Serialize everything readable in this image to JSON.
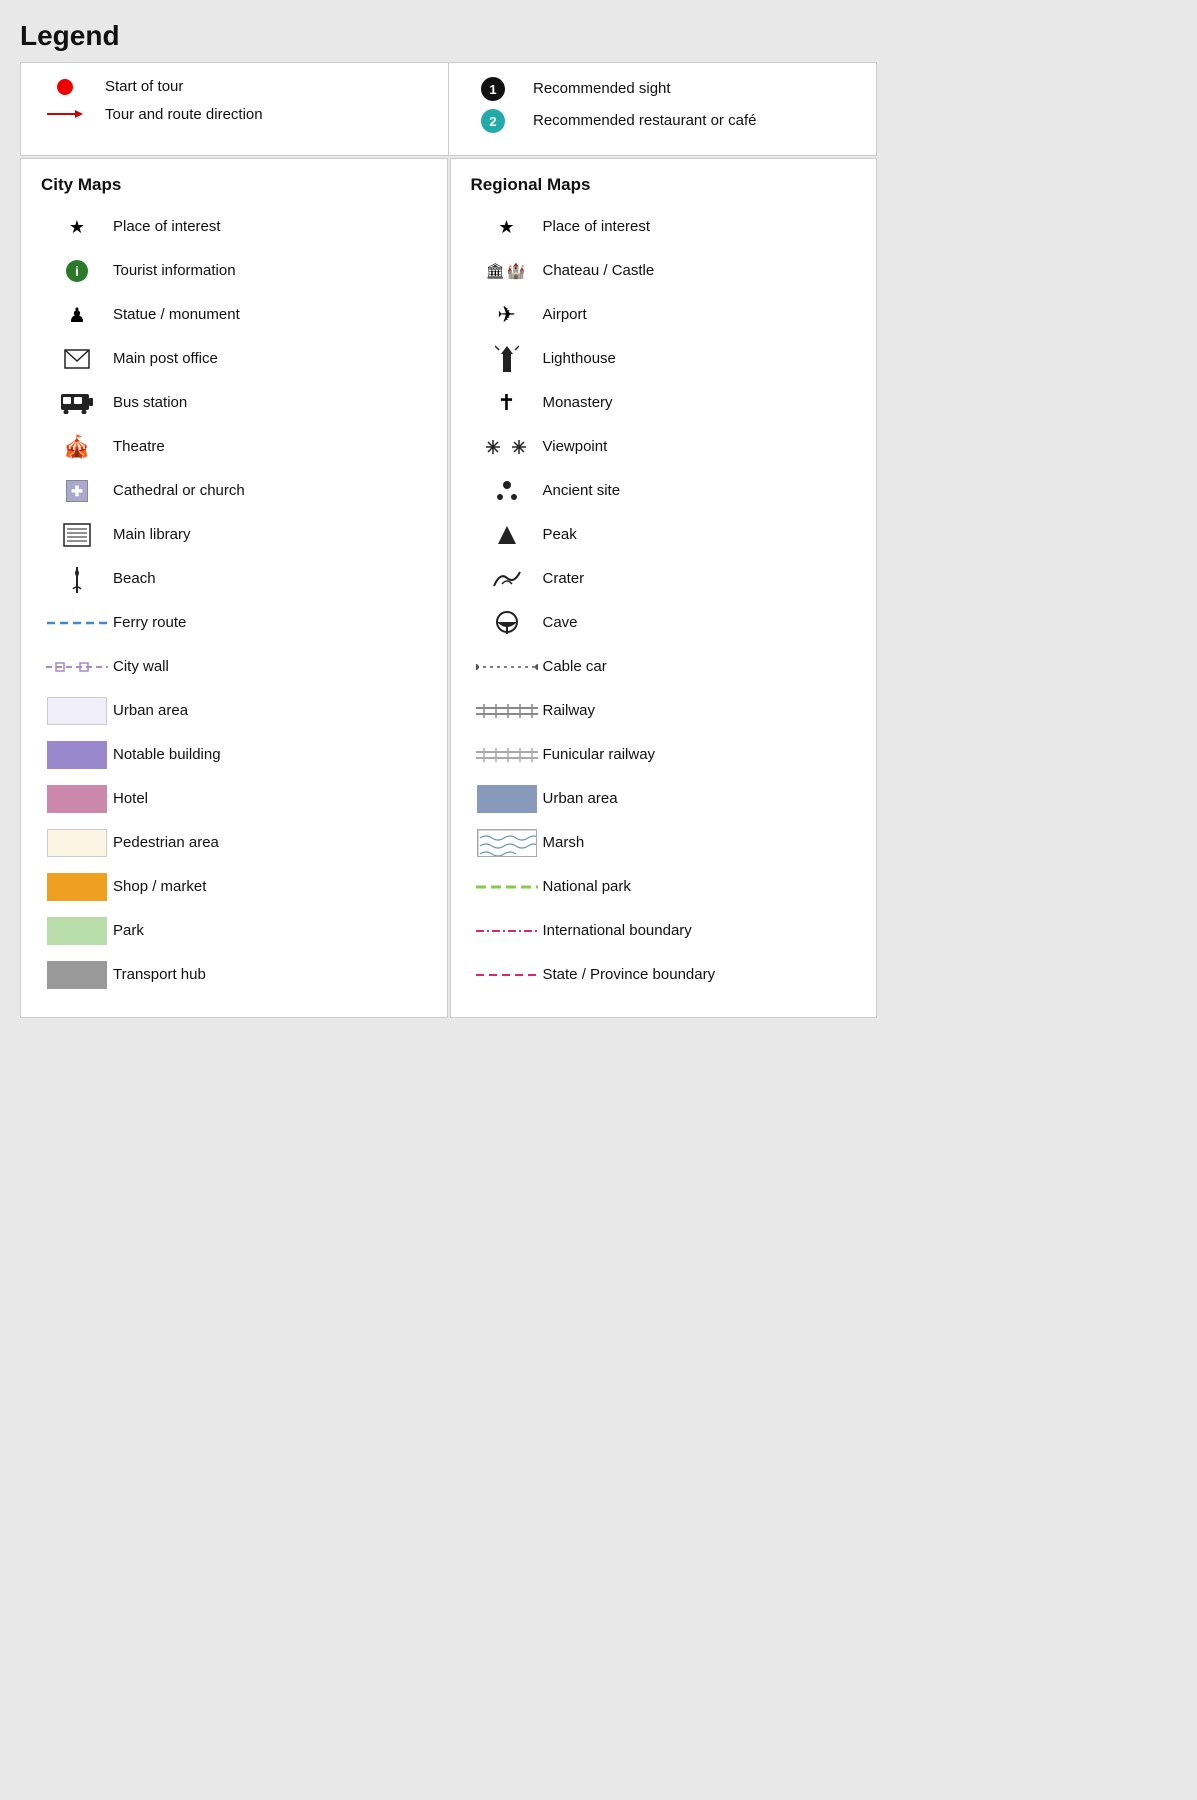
{
  "title": "Legend",
  "top": {
    "left": {
      "items": [
        {
          "label": "Start of tour",
          "icon": "red-dot"
        },
        {
          "label": "Tour and route direction",
          "icon": "arrow-red"
        }
      ]
    },
    "right": {
      "items": [
        {
          "label": "Recommended sight",
          "icon": "num1-black"
        },
        {
          "label": "Recommended restaurant or café",
          "icon": "num2-green"
        }
      ]
    }
  },
  "cityMaps": {
    "title": "City Maps",
    "items": [
      {
        "label": "Place of interest",
        "icon": "star"
      },
      {
        "label": "Tourist information",
        "icon": "info-green"
      },
      {
        "label": "Statue / monument",
        "icon": "chess"
      },
      {
        "label": "Main post office",
        "icon": "envelope"
      },
      {
        "label": "Bus station",
        "icon": "bus"
      },
      {
        "label": "Theatre",
        "icon": "theatre"
      },
      {
        "label": "Cathedral or church",
        "icon": "church-cross"
      },
      {
        "label": "Main library",
        "icon": "library"
      },
      {
        "label": "Beach",
        "icon": "beach"
      },
      {
        "label": "Ferry route",
        "icon": "ferry-dashed"
      },
      {
        "label": "City wall",
        "icon": "city-wall"
      },
      {
        "label": "Urban area",
        "icon": "swatch-urban-city"
      },
      {
        "label": "Notable building",
        "icon": "swatch-notable"
      },
      {
        "label": "Hotel",
        "icon": "swatch-hotel"
      },
      {
        "label": "Pedestrian area",
        "icon": "swatch-pedestrian"
      },
      {
        "label": "Shop / market",
        "icon": "swatch-shop"
      },
      {
        "label": "Park",
        "icon": "swatch-park"
      },
      {
        "label": "Transport hub",
        "icon": "swatch-transport"
      }
    ]
  },
  "regionalMaps": {
    "title": "Regional Maps",
    "items": [
      {
        "label": "Place of interest",
        "icon": "star"
      },
      {
        "label": "Chateau / Castle",
        "icon": "chateau"
      },
      {
        "label": "Airport",
        "icon": "airport"
      },
      {
        "label": "Lighthouse",
        "icon": "lighthouse"
      },
      {
        "label": "Monastery",
        "icon": "monastery"
      },
      {
        "label": "Viewpoint",
        "icon": "viewpoint"
      },
      {
        "label": "Ancient site",
        "icon": "ancient"
      },
      {
        "label": "Peak",
        "icon": "peak"
      },
      {
        "label": "Crater",
        "icon": "crater"
      },
      {
        "label": "Cave",
        "icon": "cave"
      },
      {
        "label": "Cable car",
        "icon": "cable-car"
      },
      {
        "label": "Railway",
        "icon": "railway"
      },
      {
        "label": "Funicular railway",
        "icon": "funicular"
      },
      {
        "label": "Urban area",
        "icon": "swatch-urban-regional"
      },
      {
        "label": "Marsh",
        "icon": "swatch-marsh"
      },
      {
        "label": "National park",
        "icon": "natpark"
      },
      {
        "label": "International boundary",
        "icon": "intl-boundary"
      },
      {
        "label": "State / Province boundary",
        "icon": "state-boundary"
      }
    ]
  }
}
